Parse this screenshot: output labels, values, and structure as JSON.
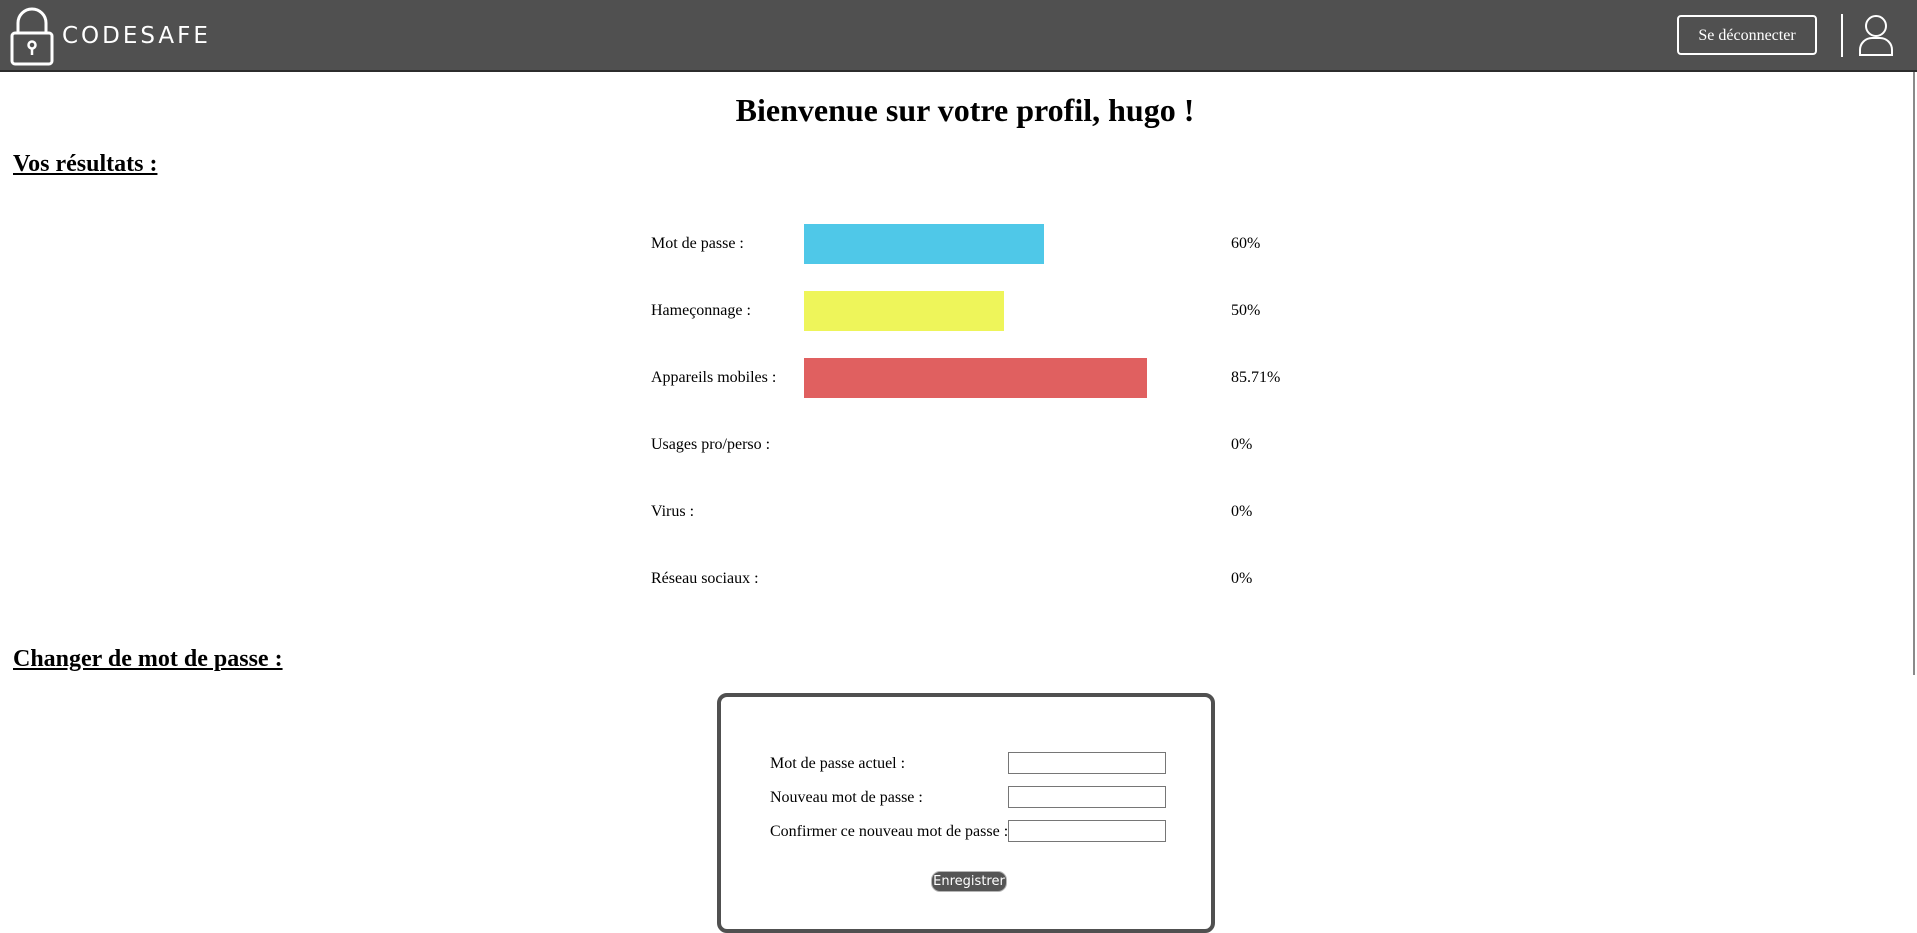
{
  "header": {
    "brand": "CODESAFE",
    "logout_label": "Se déconnecter",
    "user_icon": "user-icon",
    "logo_icon": "padlock-icon"
  },
  "main": {
    "welcome_title": "Bienvenue sur votre profil, hugo !",
    "results_title": "Vos résultats :",
    "password_title": "Changer de mot de passe :"
  },
  "results": [
    {
      "label": "Mot de passe :",
      "value": "60%",
      "percent": 60,
      "color": "#4fc8e8"
    },
    {
      "label": "Hameçonnage :",
      "value": "50%",
      "percent": 50,
      "color": "#eef55a"
    },
    {
      "label": "Appareils mobiles :",
      "value": "85.71%",
      "percent": 85.71,
      "color": "#e06060"
    },
    {
      "label": "Usages pro/perso :",
      "value": "0%",
      "percent": 0,
      "color": "#cccccc"
    },
    {
      "label": "Virus :",
      "value": "0%",
      "percent": 0,
      "color": "#cccccc"
    },
    {
      "label": "Réseau sociaux :",
      "value": "0%",
      "percent": 0,
      "color": "#cccccc"
    }
  ],
  "password_form": {
    "current_label": "Mot de passe actuel :",
    "current_value": "",
    "new_label": "Nouveau mot de passe :",
    "new_value": "",
    "confirm_label": "Confirmer ce nouveau mot de passe :",
    "confirm_value": "",
    "save_label": "Enregistrer"
  }
}
